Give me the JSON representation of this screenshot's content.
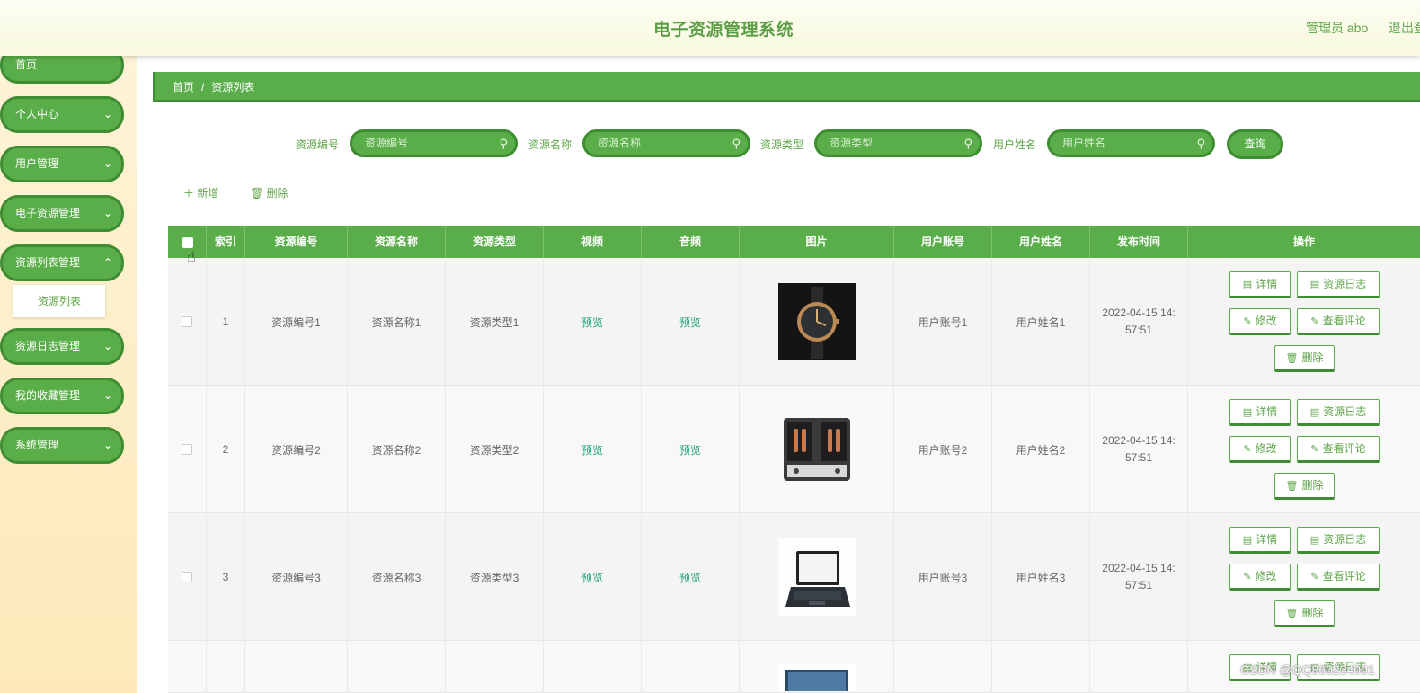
{
  "header": {
    "title": "电子资源管理系统",
    "user_label": "管理员 abo",
    "logout_label": "退出登录"
  },
  "sidebar": {
    "items": [
      {
        "label": "首页"
      },
      {
        "label": "个人中心"
      },
      {
        "label": "用户管理"
      },
      {
        "label": "电子资源管理"
      },
      {
        "label": "资源列表管理"
      },
      {
        "label": "资源日志管理"
      },
      {
        "label": "我的收藏管理"
      },
      {
        "label": "系统管理"
      }
    ],
    "sub_item": "资源列表",
    "chevron": "chevron-down-icon"
  },
  "breadcrumb": {
    "home": "首页",
    "separator": "/",
    "current": "资源列表"
  },
  "search": {
    "fields": [
      {
        "label": "资源编号",
        "placeholder": "资源编号"
      },
      {
        "label": "资源名称",
        "placeholder": "资源名称"
      },
      {
        "label": "资源类型",
        "placeholder": "资源类型"
      },
      {
        "label": "用户姓名",
        "placeholder": "用户姓名"
      }
    ],
    "query_label": "查询"
  },
  "toolbar": {
    "add_label": "新增",
    "delete_label": "删除"
  },
  "table": {
    "columns": [
      "索引",
      "资源编号",
      "资源名称",
      "资源类型",
      "视频",
      "音频",
      "图片",
      "用户账号",
      "用户姓名",
      "发布时间",
      "操作"
    ],
    "rows": [
      {
        "index": "1",
        "code": "资源编号1",
        "name": "资源名称1",
        "type": "资源类型1",
        "video": "预览",
        "audio": "预览",
        "image": "watch",
        "account": "用户账号1",
        "username": "用户姓名1",
        "date_line1": "2022-04-15 14:",
        "date_line2": "57:51"
      },
      {
        "index": "2",
        "code": "资源编号2",
        "name": "资源名称2",
        "type": "资源类型2",
        "video": "预览",
        "audio": "预览",
        "image": "amplifier",
        "account": "用户账号2",
        "username": "用户姓名2",
        "date_line1": "2022-04-15 14:",
        "date_line2": "57:51"
      },
      {
        "index": "3",
        "code": "资源编号3",
        "name": "资源名称3",
        "type": "资源类型3",
        "video": "预览",
        "audio": "预览",
        "image": "laptop",
        "account": "用户账号3",
        "username": "用户姓名3",
        "date_line1": "2022-04-15 14:",
        "date_line2": "57:51"
      }
    ],
    "actions": {
      "detail": "详情",
      "log": "资源日志",
      "edit": "修改",
      "comments": "查看评论",
      "delete": "删除"
    }
  },
  "watermark": "CSDN @QQ860234001",
  "colors": {
    "primary": "#5aae4a",
    "primary_dark": "#3f8d33",
    "title_text": "#5b9e46",
    "sidebar_bg": "#fdeec5",
    "link": "#27a37b"
  }
}
